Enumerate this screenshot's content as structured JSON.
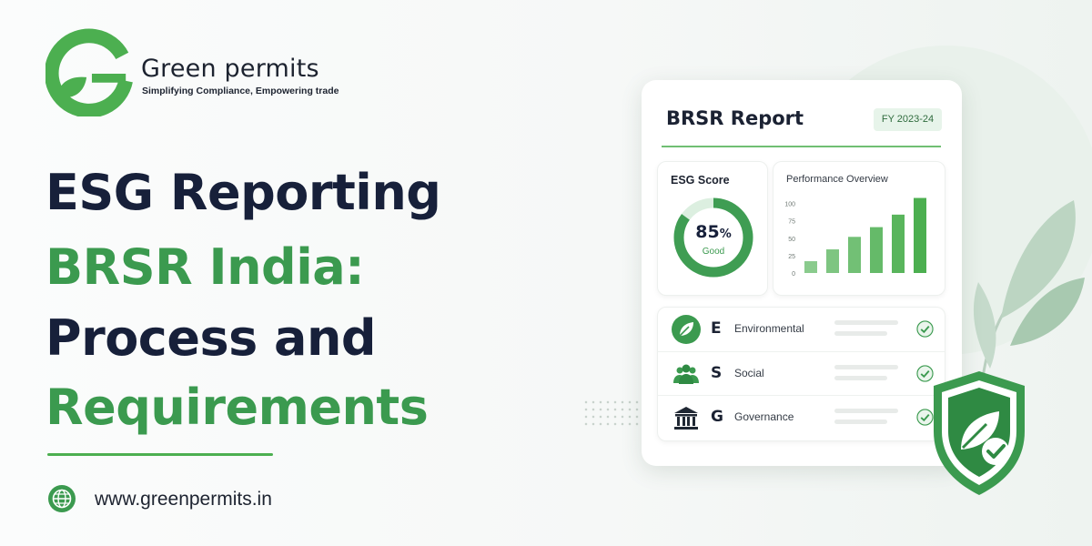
{
  "brand": {
    "name": "Green permits",
    "tagline": "Simplifying Compliance, Empowering trade",
    "logo_icon": "leaf-g-logo-icon",
    "accent_color": "#3b9a4f"
  },
  "headline": {
    "line1": "ESG Reporting",
    "line2": "BRSR India:",
    "line3": "Process and",
    "line4": "Requirements"
  },
  "footer": {
    "website": "www.greenpermits.in",
    "icon": "globe-icon"
  },
  "report_card": {
    "title": "BRSR Report",
    "fiscal_year": "FY 2023-24",
    "esg_score": {
      "title": "ESG Score",
      "value": "85",
      "unit": "%",
      "progress": 0.85,
      "rating": "Good"
    },
    "performance": {
      "title": "Performance Overview"
    },
    "pillars": [
      {
        "letter": "E",
        "label": "Environmental",
        "icon": "leaf-icon",
        "status": "check-icon"
      },
      {
        "letter": "S",
        "label": "Social",
        "icon": "people-icon",
        "status": "check-icon"
      },
      {
        "letter": "G",
        "label": "Governance",
        "icon": "institution-icon",
        "status": "check-icon"
      }
    ]
  },
  "badge": {
    "icon": "shield-leaf-check-icon"
  },
  "chart_data": {
    "type": "bar",
    "title": "Performance Overview",
    "categories": [
      "",
      "",
      "",
      "",
      "",
      ""
    ],
    "values": [
      17,
      34,
      52,
      66,
      84,
      108
    ],
    "yticks": [
      "0",
      "25",
      "50",
      "75",
      "100"
    ],
    "ylim": [
      0,
      110
    ],
    "grid": false,
    "color": "#4caf50"
  }
}
